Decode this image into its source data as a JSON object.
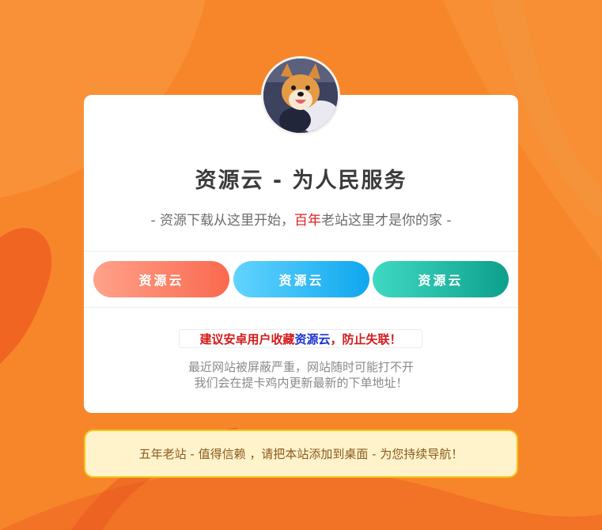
{
  "header": {
    "title": "资源云 - 为人民服务",
    "subtitle_prefix": "- 资源下载从这里开始，",
    "subtitle_highlight": "百年",
    "subtitle_suffix": "老站这里才是你的家 -"
  },
  "buttons": [
    {
      "label": "资源云"
    },
    {
      "label": "资源云"
    },
    {
      "label": "资源云"
    }
  ],
  "notice": {
    "tip_prefix": "建议安卓用户收藏",
    "tip_highlight": "资源云",
    "tip_suffix": "，防止失联！",
    "line1": "最近网站被屏蔽严重，网站随时可能打不开",
    "line2": "我们会在提卡鸡内更新最新的下单地址！"
  },
  "footer": {
    "text": "五年老站 - 值得信赖 ，请把本站添加到桌面 - 为您持续导航！"
  },
  "colors": {
    "background": "#f7862a",
    "highlight_red": "#e02020",
    "highlight_blue": "#1a2fd4",
    "footer_bg": "#fff3cc",
    "footer_border": "#f5c518"
  }
}
